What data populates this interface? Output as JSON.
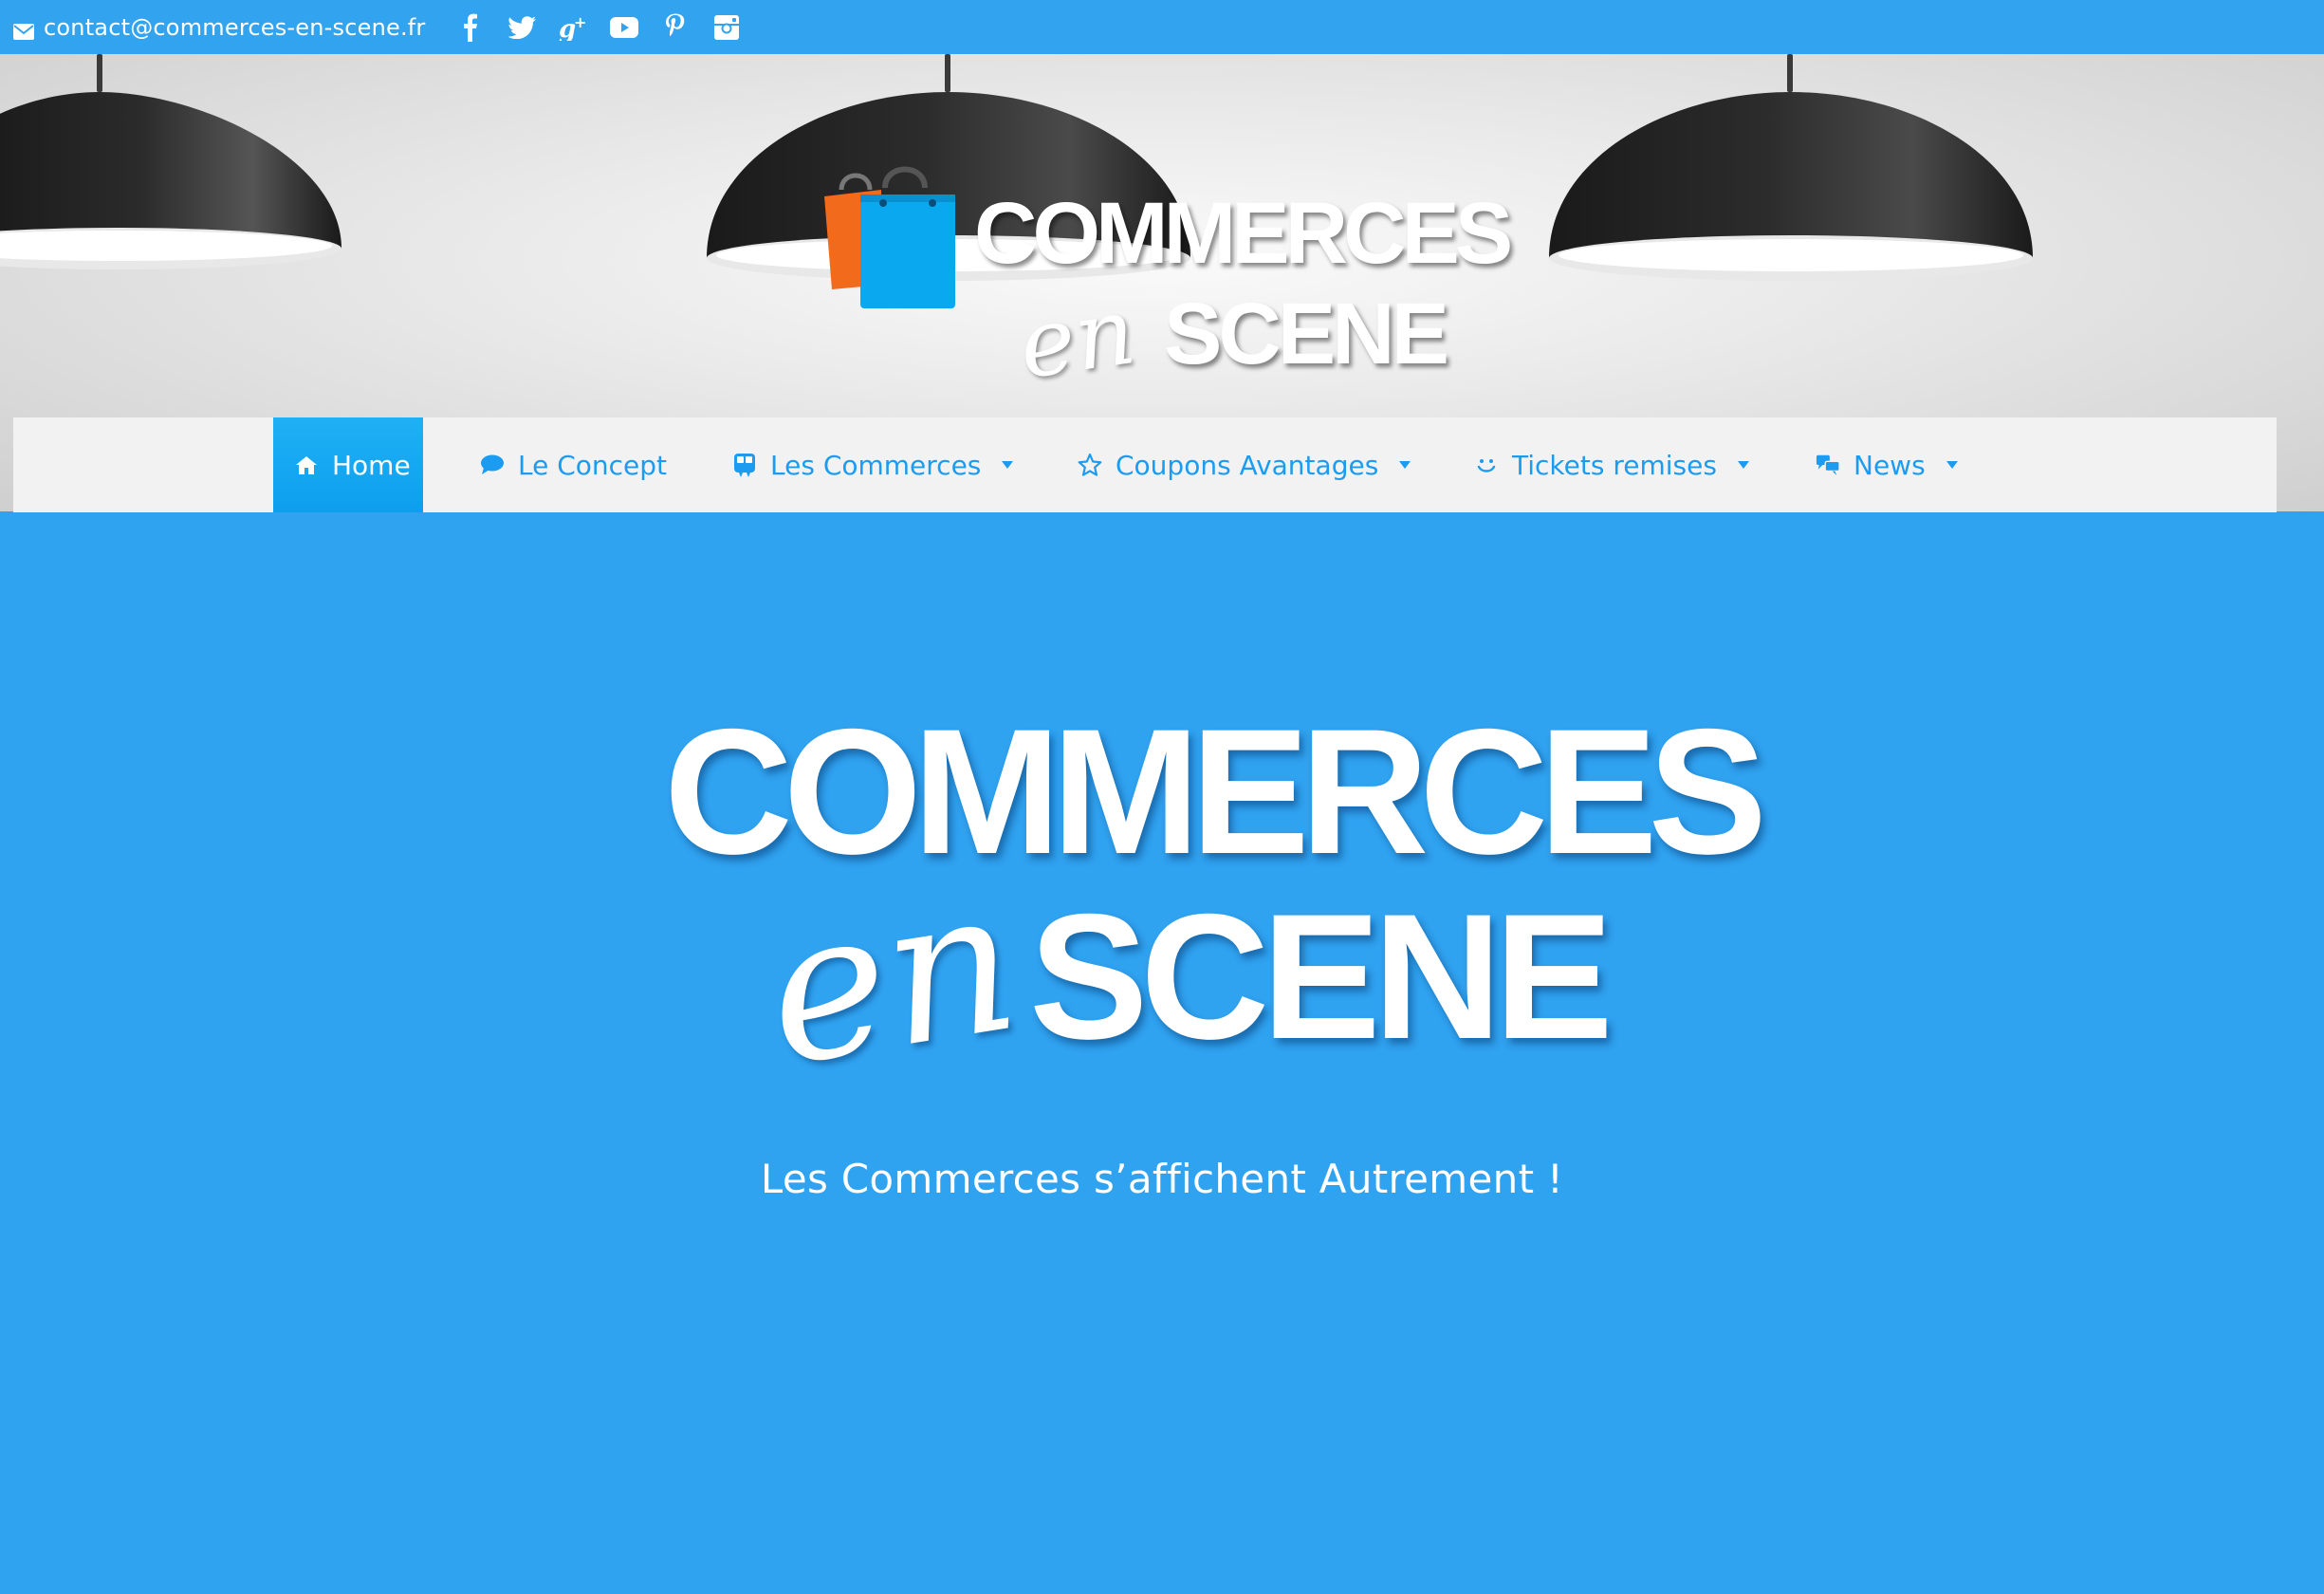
{
  "topbar": {
    "email": "contact@commerces-en-scene.fr",
    "social": [
      {
        "icon": "facebook-icon",
        "glyph": "f"
      },
      {
        "icon": "twitter-icon",
        "glyph": ""
      },
      {
        "icon": "google-plus-icon",
        "glyph": "g+"
      },
      {
        "icon": "youtube-icon",
        "glyph": ""
      },
      {
        "icon": "pinterest-icon",
        "glyph": "p"
      },
      {
        "icon": "instagram-icon",
        "glyph": ""
      }
    ]
  },
  "header": {
    "logo_line1": "COMMERCES",
    "logo_script": "en",
    "logo_line2": "SCENE"
  },
  "nav": {
    "items": [
      {
        "label": "Home",
        "icon": "home-icon",
        "active": true,
        "dropdown": false
      },
      {
        "label": "Le Concept",
        "icon": "speech-bubble-icon",
        "active": false,
        "dropdown": false
      },
      {
        "label": "Les Commerces",
        "icon": "storefront-icon",
        "active": false,
        "dropdown": true
      },
      {
        "label": "Coupons Avantages",
        "icon": "star-icon",
        "active": false,
        "dropdown": true
      },
      {
        "label": "Tickets remises",
        "icon": "smile-icon",
        "active": false,
        "dropdown": true
      },
      {
        "label": "News",
        "icon": "chat-bubbles-icon",
        "active": false,
        "dropdown": true
      }
    ]
  },
  "hero": {
    "line1": "COMMERCES",
    "script": "en",
    "line2": "SCENE",
    "tagline": "Les Commerces s’affichent Autrement !"
  },
  "colors": {
    "topbar": "#31a3ef",
    "main_bg": "#2fa2f0",
    "nav_bg": "#f2f2f2",
    "nav_text": "#1b9cf0",
    "nav_active": "#0da6f0",
    "bag_orange": "#f26a1b",
    "bag_blue": "#0aa9ef"
  }
}
